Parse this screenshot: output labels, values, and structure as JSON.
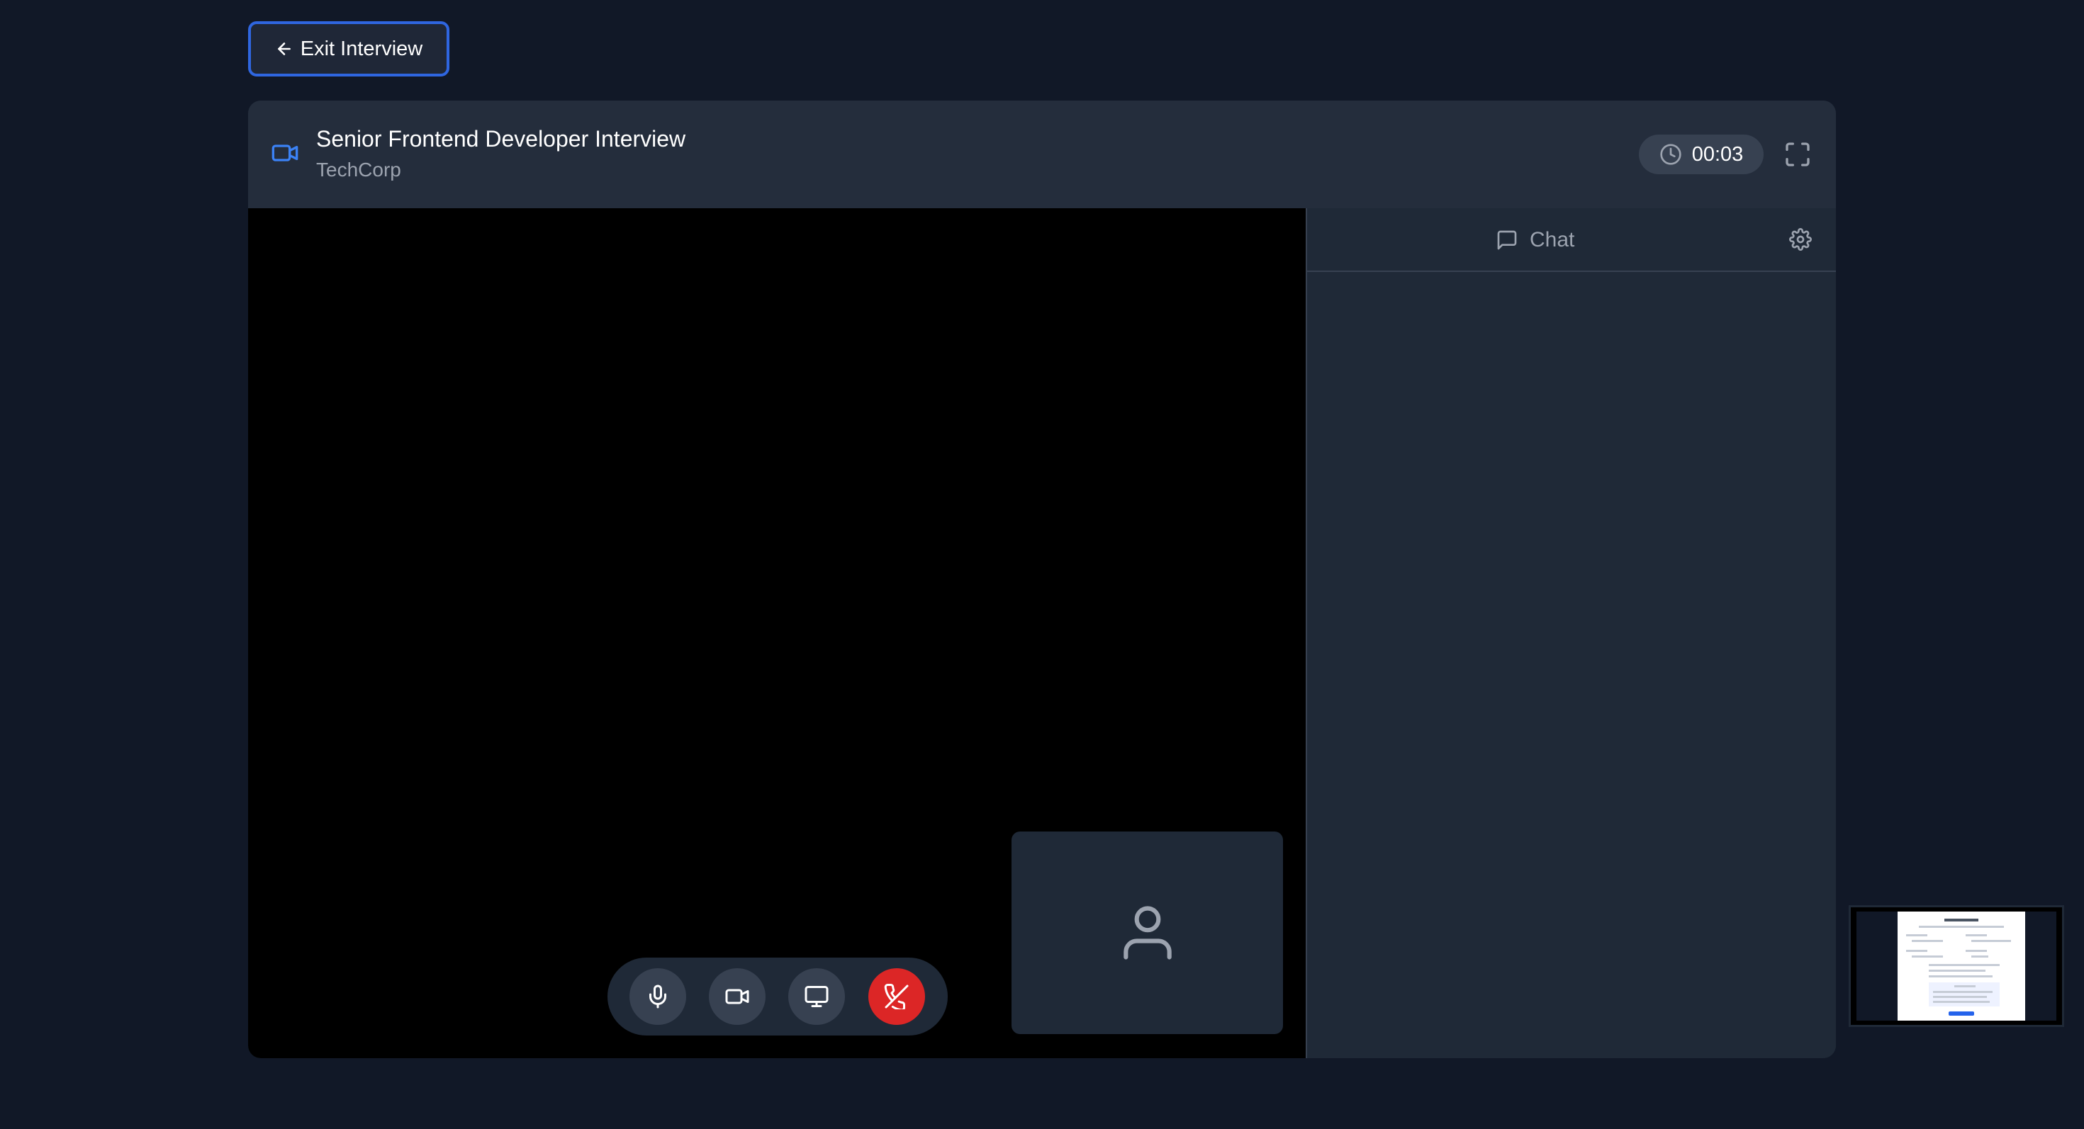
{
  "exit_button": {
    "label": "Exit Interview",
    "icon": "arrow-left-icon"
  },
  "header": {
    "title": "Senior Frontend Developer Interview",
    "company": "TechCorp",
    "timer": "00:03",
    "accent_color": "#3b82f6"
  },
  "controls": {
    "mic": "microphone-icon",
    "camera": "video-camera-icon",
    "screen_share": "monitor-icon",
    "end_call": "phone-off-icon",
    "end_call_color": "#dc2626"
  },
  "chat": {
    "tab_label": "Chat"
  },
  "colors": {
    "background": "#111827",
    "card": "#1f2937",
    "exit_border": "#2f66e0"
  }
}
